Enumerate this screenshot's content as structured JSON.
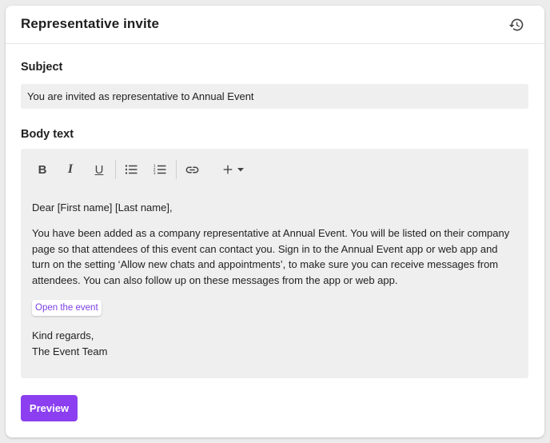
{
  "header": {
    "title": "Representative invite",
    "history_icon": "history-icon"
  },
  "subject": {
    "label": "Subject",
    "value": "You are invited as representative to Annual Event"
  },
  "body": {
    "label": "Body text",
    "toolbar": {
      "bold_label": "B",
      "italic_label": "I",
      "underline_label": "U",
      "icons": [
        "bulleted-list-icon",
        "numbered-list-icon",
        "link-icon",
        "plus-icon",
        "caret-down-icon"
      ]
    },
    "greeting": "Dear [First name] [Last name],",
    "paragraph": "You have been added as a company representative at Annual Event. You will be listed on their company page so that attendees of this event can contact you. Sign in to the Annual Event app or web app and turn on the setting ‘Allow new chats and appointments’, to make sure you can receive messages from attendees. You can also follow up on these messages from the app or web app.",
    "event_button_label": "Open the event",
    "signoff": "Kind regards,",
    "signature": "The Event Team"
  },
  "actions": {
    "preview_label": "Preview"
  },
  "colors": {
    "accent": "#8b3ff0",
    "link": "#7b3fe4",
    "field_bg": "#efefef"
  }
}
